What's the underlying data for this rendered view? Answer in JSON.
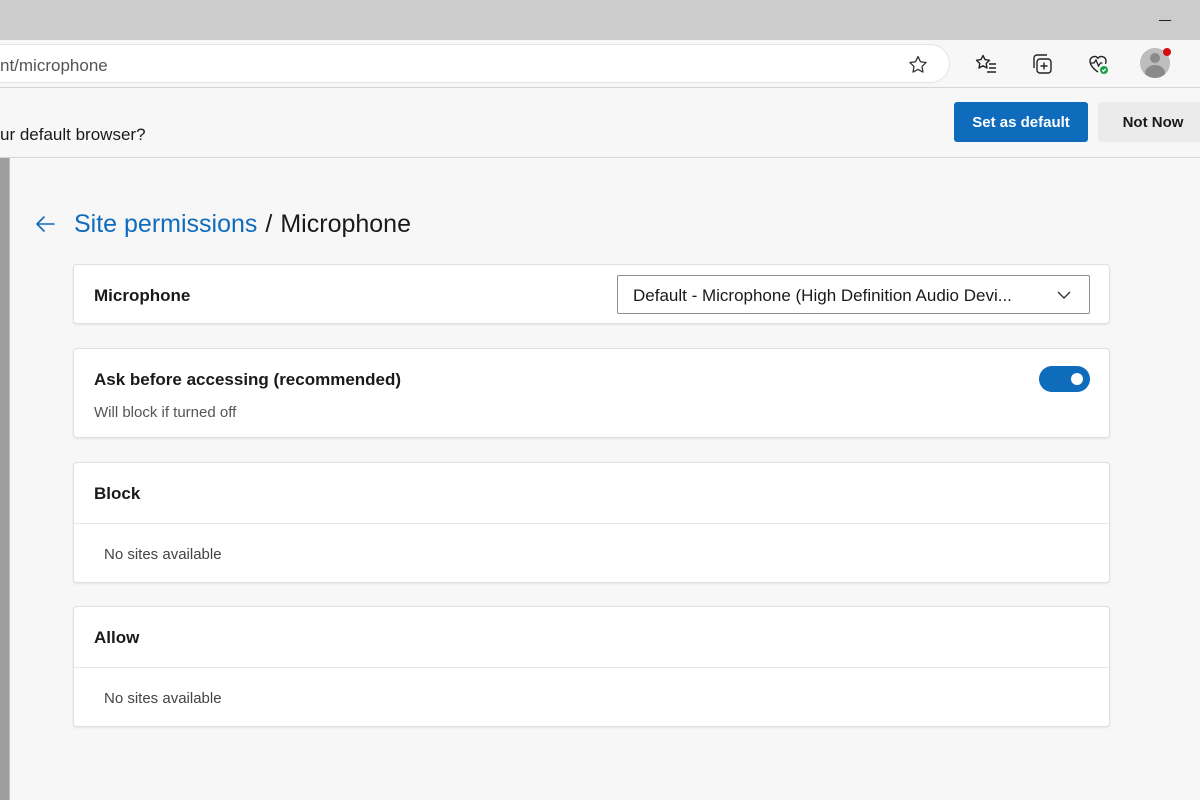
{
  "browser": {
    "address_bar": {
      "url_text": "nt/microphone"
    },
    "icons": [
      "favorite-star-icon",
      "favorites-icon",
      "collections-icon",
      "browser-essentials-icon",
      "profile-avatar"
    ]
  },
  "infobar": {
    "message": "ur default browser?",
    "set_default_label": "Set as default",
    "not_now_label": "Not Now"
  },
  "page": {
    "breadcrumb_parent": "Site permissions",
    "breadcrumb_separator": "/",
    "breadcrumb_current": "Microphone"
  },
  "microphone_card": {
    "label": "Microphone",
    "selected_device": "Default - Microphone (High Definition Audio Devi..."
  },
  "ask_card": {
    "title": "Ask before accessing (recommended)",
    "subtitle": "Will block if turned off",
    "toggle_on": true
  },
  "block_card": {
    "title": "Block",
    "empty_text": "No sites available"
  },
  "allow_card": {
    "title": "Allow",
    "empty_text": "No sites available"
  },
  "colors": {
    "accent": "#0f6cbd",
    "page_bg": "#f7f7f7",
    "card_bg": "#ffffff",
    "notification_dot": "#d40e0e"
  }
}
